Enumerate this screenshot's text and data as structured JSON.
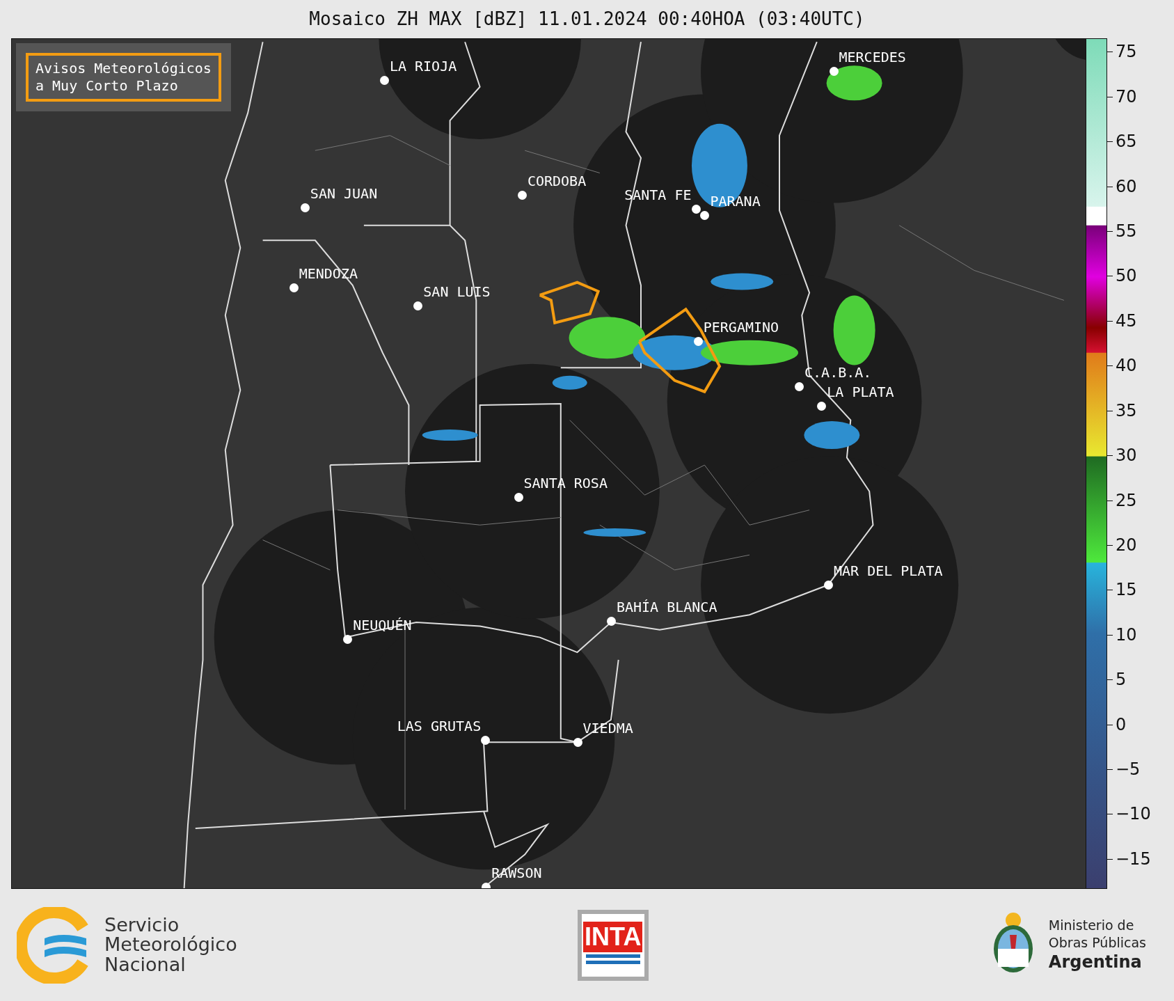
{
  "title": "Mosaico ZH MAX [dBZ] 11.01.2024 00:40HOA (03:40UTC)",
  "legend": {
    "lines": [
      "Avisos Meteorológicos",
      "a Muy Corto Plazo"
    ]
  },
  "cities": [
    {
      "name": "LA RIOJA"
    },
    {
      "name": "MERCEDES"
    },
    {
      "name": "CORDOBA"
    },
    {
      "name": "SAN JUAN"
    },
    {
      "name": "SANTA FE"
    },
    {
      "name": "PARANA"
    },
    {
      "name": "MENDOZA"
    },
    {
      "name": "SAN LUIS"
    },
    {
      "name": "PERGAMINO"
    },
    {
      "name": "C.A.B.A."
    },
    {
      "name": "LA PLATA"
    },
    {
      "name": "SANTA ROSA"
    },
    {
      "name": "MAR DEL PLATA"
    },
    {
      "name": "BAHÍA BLANCA"
    },
    {
      "name": "NEUQUÉN"
    },
    {
      "name": "LAS GRUTAS"
    },
    {
      "name": "VIEDMA"
    },
    {
      "name": "RAWSON"
    }
  ],
  "colorbar_ticks": [
    "75",
    "70",
    "65",
    "60",
    "55",
    "50",
    "45",
    "40",
    "35",
    "30",
    "25",
    "20",
    "15",
    "10",
    "5",
    "0",
    "−5",
    "−10",
    "−15"
  ],
  "footer": {
    "smn_lines": [
      "Servicio",
      "Meteorológico",
      "Nacional"
    ],
    "inta_text": "INTA",
    "ministry_lines": [
      "Ministerio de",
      "Obras Públicas",
      "Argentina"
    ]
  }
}
